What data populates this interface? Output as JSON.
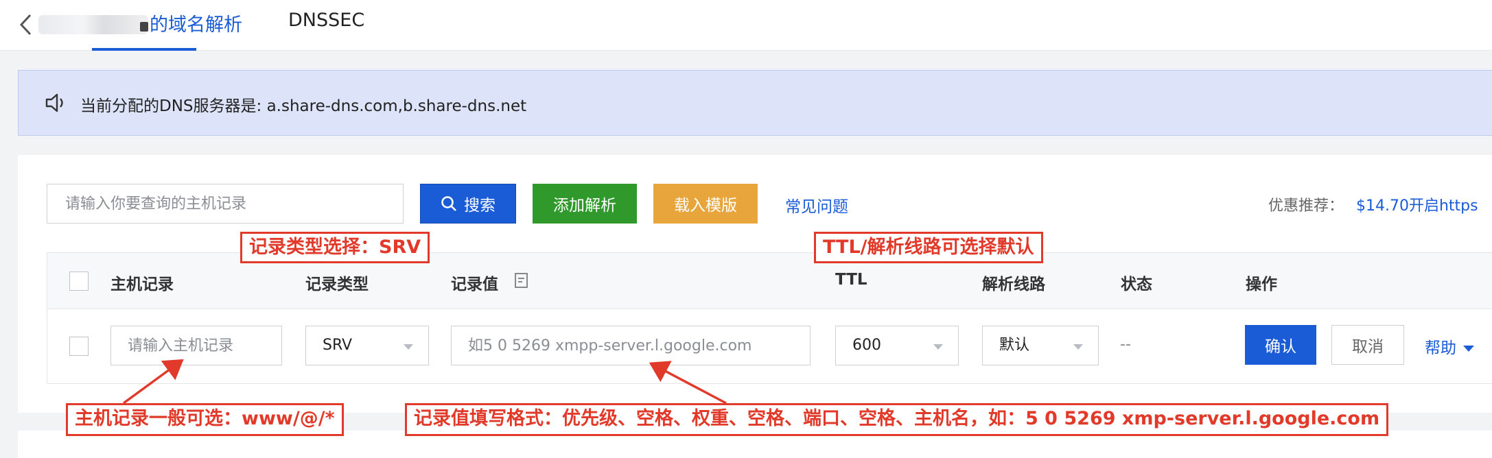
{
  "topbar": {
    "domain_tab": "的域名解析",
    "dnssec_tab": "DNSSEC"
  },
  "notice": {
    "text": "当前分配的DNS服务器是: a.share-dns.com,b.share-dns.net"
  },
  "toolbar": {
    "search_placeholder": "请输入你要查询的主机记录",
    "search_label": "搜索",
    "add_label": "添加解析",
    "template_label": "载入模版",
    "faq_label": "常见问题",
    "promo_label": "优惠推荐：",
    "promo_link": "$14.70开启https"
  },
  "table": {
    "headers": {
      "host": "主机记录",
      "type": "记录类型",
      "value": "记录值",
      "ttl": "TTL",
      "line": "解析线路",
      "status": "状态",
      "action": "操作"
    },
    "row": {
      "host_placeholder": "请输入主机记录",
      "type": "SRV",
      "value_placeholder": "如5 0 5269 xmpp-server.l.google.com",
      "ttl": "600",
      "line": "默认",
      "status": "--",
      "confirm_label": "确认",
      "cancel_label": "取消",
      "help_label": "帮助"
    }
  },
  "annotations": {
    "type": "记录类型选择：SRV",
    "ttl": "TTL/解析线路可选择默认",
    "host": "主机记录一般可选：www/@/*",
    "value": "记录值填写格式：优先级、空格、权重、空格、端口、空格、主机名，如：5 0 5269 xmp-server.l.google.com"
  },
  "colors": {
    "primary": "#1a5bd6",
    "success": "#2f9a2b",
    "warning": "#e8a53c",
    "annotation": "#e23a2a"
  },
  "icons": {
    "back": "chevron-left-icon",
    "notice": "speaker-icon",
    "search": "search-icon",
    "value_help": "document-icon",
    "help": "caret-down-icon"
  }
}
